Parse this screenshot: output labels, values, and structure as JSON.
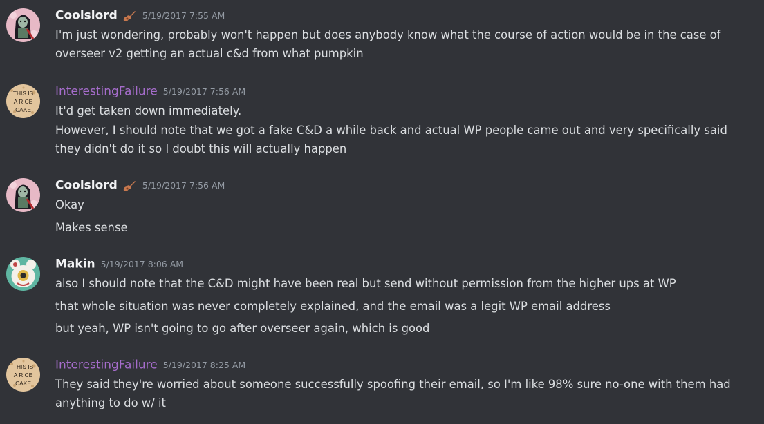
{
  "messages": [
    {
      "username": "Coolslord",
      "timestamp": "5/19/2017 7:55 AM",
      "lines": [
        "I'm just wondering, probably won't happen but does anybody know what the course of action would be in the case of overseer v2 getting an actual c&d from what pumpkin"
      ]
    },
    {
      "username": "InterestingFailure",
      "timestamp": "5/19/2017 7:56 AM",
      "avatar_text": [
        "THIS IS",
        "A RICE",
        "CAKE"
      ],
      "lines": [
        "It'd get taken down immediately.",
        "However, I should note that we got a fake C&D a while back and actual WP people came out and very specifically said they didn't do it so I doubt this will actually happen"
      ]
    },
    {
      "username": "Coolslord",
      "timestamp": "5/19/2017 7:56 AM",
      "lines": [
        "Okay",
        "Makes sense"
      ]
    },
    {
      "username": "Makin",
      "timestamp": "5/19/2017 8:06 AM",
      "lines": [
        "also I should note that the C&D might have been real but send without permission from the higher ups at WP",
        "that whole situation was never completely explained, and the email was a legit WP email address",
        "but yeah, WP isn't going to go after overseer again, which is good"
      ]
    },
    {
      "username": "InterestingFailure",
      "timestamp": "5/19/2017 8:25 AM",
      "avatar_text": [
        "THIS IS",
        "A RICE",
        "CAKE"
      ],
      "lines": [
        "They said they're worried about someone successfully spoofing their email, so I'm like 98% sure no-one with them had anything to do w/ it"
      ]
    }
  ],
  "colors": {
    "background": "#313338",
    "text": "#dbdee1",
    "username": "#f2f3f5",
    "username_role": "#a66dcc",
    "timestamp": "#949ba4"
  },
  "icons": {
    "coolslord_badge": "guitar-icon",
    "coolslord_avatar": "vampire-girl-avatar",
    "makin_avatar": "eyeball-bear-avatar",
    "interestingfailure_avatar": "rice-cake-avatar"
  }
}
